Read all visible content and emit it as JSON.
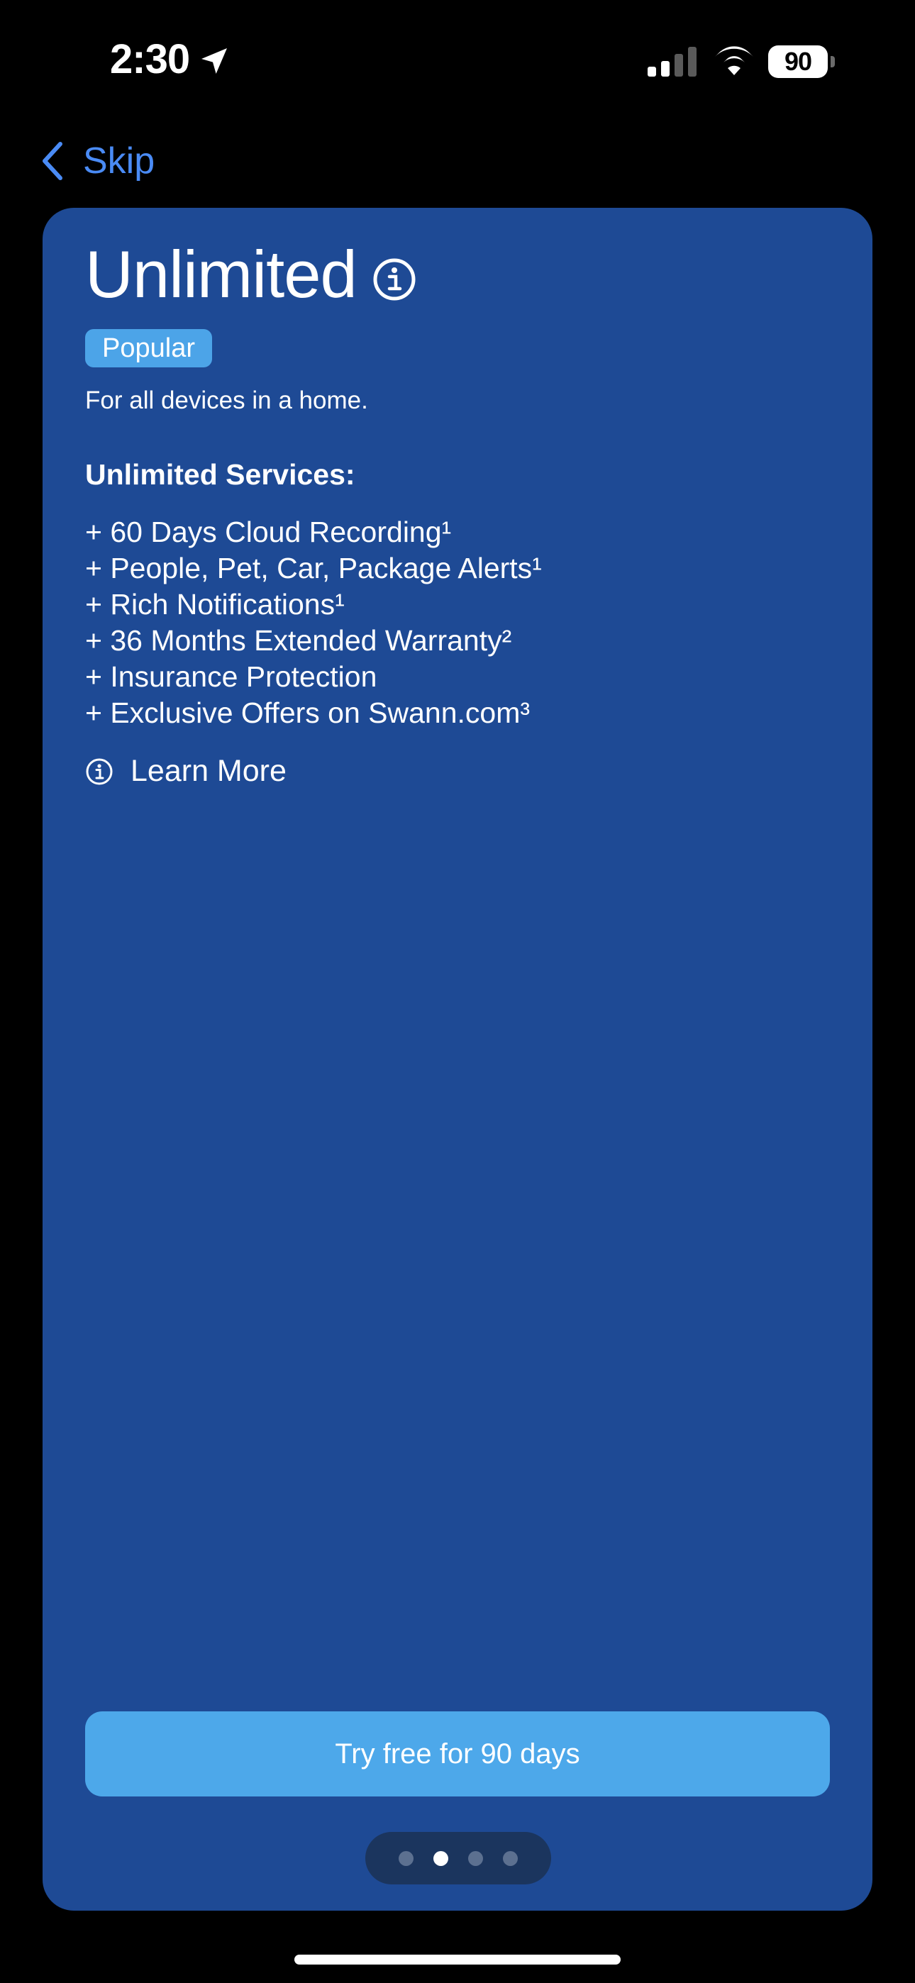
{
  "status_bar": {
    "time": "2:30",
    "battery": "90",
    "icons": [
      "location-arrow-icon",
      "cellular-signal-icon",
      "wifi-icon",
      "battery-icon"
    ]
  },
  "nav": {
    "back_icon": "chevron-left-icon",
    "skip_label": "Skip",
    "accent_color": "#4a8bf5"
  },
  "plan": {
    "title": "Unlimited",
    "info_icon": "info-circle-icon",
    "badge": "Popular",
    "subtitle": "For all devices in a home.",
    "services_heading": "Unlimited Services:",
    "services": [
      "+ 60 Days Cloud Recording¹",
      "+ People, Pet, Car, Package Alerts¹",
      "+ Rich Notifications¹",
      "+ 36 Months Extended Warranty²",
      "+ Insurance Protection",
      "+ Exclusive Offers on Swann.com³"
    ],
    "learn_more": "Learn More",
    "card_color": "#1e4a95",
    "badge_color": "#4ca4e8"
  },
  "cta": {
    "label": "Try free for 90 days",
    "color": "#4da8ea"
  },
  "pager": {
    "total": 4,
    "active_index": 1
  }
}
